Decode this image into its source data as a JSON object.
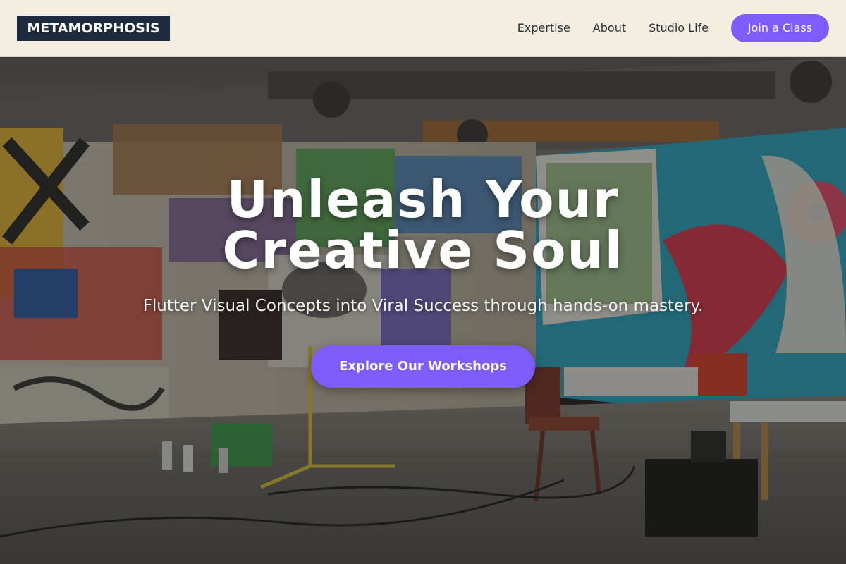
{
  "header": {
    "logo": "METAMORPHOSIS",
    "nav": [
      {
        "label": "Expertise"
      },
      {
        "label": "About"
      },
      {
        "label": "Studio Life"
      }
    ],
    "cta_label": "Join a Class"
  },
  "hero": {
    "title_line1": "Unleash Your",
    "title_line2": "Creative Soul",
    "subtitle": "Flutter Visual Concepts into Viral Success through hands-on mastery.",
    "button_label": "Explore Our Workshops",
    "background_image": "graffiti art studio interior"
  },
  "colors": {
    "accent": "#7c5cfa",
    "header_bg": "#f3eedf",
    "logo_bg": "#1e2a3d"
  }
}
